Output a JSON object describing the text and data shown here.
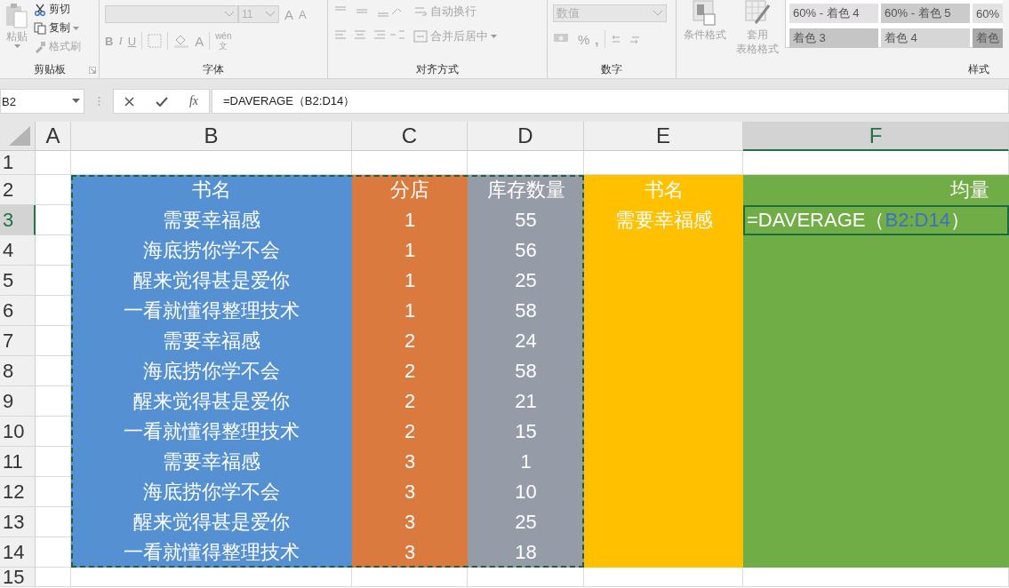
{
  "ribbon": {
    "clipboard": {
      "label": "剪贴板",
      "paste": "粘贴",
      "cut": "剪切",
      "copy": "复制",
      "format_painter": "格式刷"
    },
    "font": {
      "label": "字体",
      "size": "11",
      "grow": "A",
      "shrink": "A",
      "bold": "B",
      "italic": "I",
      "underline": "U",
      "font_color": "A",
      "phonetic_top": "wén",
      "phonetic_bottom": "文"
    },
    "alignment": {
      "label": "对齐方式",
      "wrap_text": "自动换行",
      "merge_center": "合并后居中"
    },
    "number": {
      "label": "数字",
      "format": "数值",
      "percent": "%",
      "comma": ","
    },
    "styles": {
      "label": "样式",
      "conditional_formatting": "条件格式",
      "format_as_table_top": "套用",
      "format_as_table_bottom": "表格格式",
      "cell_styles": [
        {
          "label": "60% - 着色 4",
          "color": "#e4e1e4"
        },
        {
          "label": "60% - 着色 5",
          "color": "#cbcbcb"
        },
        {
          "label": "60%",
          "color": "#e3e3e3"
        },
        {
          "label": "着色 3",
          "color": "#c5c5c5"
        },
        {
          "label": "着色 4",
          "color": "#d6d6d6"
        },
        {
          "label": "着色",
          "color": "#a9a9a9"
        }
      ]
    }
  },
  "name_box": "B2",
  "formula_bar": {
    "function_label": "fx",
    "formula": "=DAVERAGE（B2:D14）"
  },
  "sheet": {
    "columns": [
      {
        "label": "A",
        "selected": false
      },
      {
        "label": "B",
        "selected": false,
        "color": "#5591d2"
      },
      {
        "label": "C",
        "selected": false,
        "color": "#da7a3e"
      },
      {
        "label": "D",
        "selected": false,
        "color": "#969ca7"
      },
      {
        "label": "E",
        "selected": false,
        "color": "#ffc000"
      },
      {
        "label": "F",
        "selected": true,
        "color": "#70ad47"
      }
    ],
    "rows": [
      {
        "label": "1",
        "selected": false,
        "filled": false,
        "cells": {}
      },
      {
        "label": "2",
        "selected": false,
        "filled": true,
        "cells": {
          "B": "书名",
          "C": "分店",
          "D": "库存数量",
          "E": "书名",
          "F": "均量"
        }
      },
      {
        "label": "3",
        "selected": true,
        "filled": true,
        "cells": {
          "B": "需要幸福感",
          "C": "1",
          "D": "55",
          "E": "需要幸福感",
          "F": {
            "kind": "formula",
            "before": "=DAVERAGE（",
            "reference": "B2:D14",
            "after": "）"
          }
        }
      },
      {
        "label": "4",
        "selected": false,
        "filled": true,
        "cells": {
          "B": "海底捞你学不会",
          "C": "1",
          "D": "56"
        }
      },
      {
        "label": "5",
        "selected": false,
        "filled": true,
        "cells": {
          "B": "醒来觉得甚是爱你",
          "C": "1",
          "D": "25"
        }
      },
      {
        "label": "6",
        "selected": false,
        "filled": true,
        "cells": {
          "B": "一看就懂得整理技术",
          "C": "1",
          "D": "58"
        }
      },
      {
        "label": "7",
        "selected": false,
        "filled": true,
        "cells": {
          "B": "需要幸福感",
          "C": "2",
          "D": "24"
        }
      },
      {
        "label": "8",
        "selected": false,
        "filled": true,
        "cells": {
          "B": "海底捞你学不会",
          "C": "2",
          "D": "58"
        }
      },
      {
        "label": "9",
        "selected": false,
        "filled": true,
        "cells": {
          "B": "醒来觉得甚是爱你",
          "C": "2",
          "D": "21"
        }
      },
      {
        "label": "10",
        "selected": false,
        "filled": true,
        "cells": {
          "B": "一看就懂得整理技术",
          "C": "2",
          "D": "15"
        }
      },
      {
        "label": "11",
        "selected": false,
        "filled": true,
        "cells": {
          "B": "需要幸福感",
          "C": "3",
          "D": "1"
        }
      },
      {
        "label": "12",
        "selected": false,
        "filled": true,
        "cells": {
          "B": "海底捞你学不会",
          "C": "3",
          "D": "10"
        }
      },
      {
        "label": "13",
        "selected": false,
        "filled": true,
        "cells": {
          "B": "醒来觉得甚是爱你",
          "C": "3",
          "D": "25"
        }
      },
      {
        "label": "14",
        "selected": false,
        "filled": true,
        "cells": {
          "B": "一看就懂得整理技术",
          "C": "3",
          "D": "18"
        }
      },
      {
        "label": "15",
        "selected": false,
        "filled": false,
        "cells": {}
      }
    ]
  }
}
